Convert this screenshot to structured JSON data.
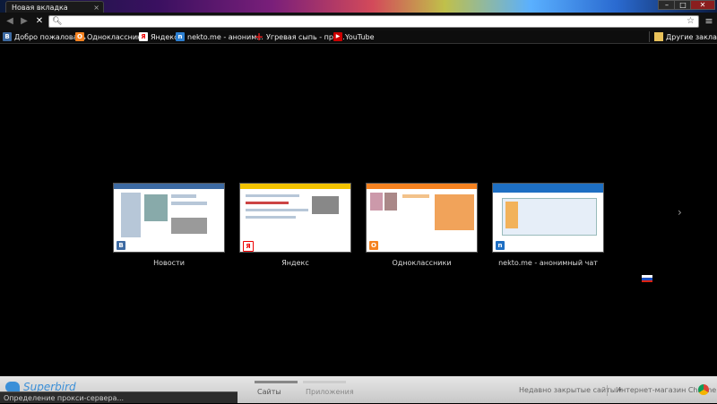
{
  "window": {
    "tab_title": "Новая вкладка",
    "tab_close": "×",
    "controls": [
      "–",
      "□",
      "✕"
    ]
  },
  "toolbar": {
    "back": "◀",
    "forward": "▶",
    "stop": "✕",
    "address_value": "",
    "search_icon": "search-icon",
    "star_icon": "star-icon",
    "menu": "≡"
  },
  "bookmarks": {
    "items": [
      {
        "label": "Добро пожаловать",
        "icon": "vk-icon",
        "color": "#3d6aa2",
        "glyph": "В"
      },
      {
        "label": "Одноклассники",
        "icon": "ok-icon",
        "color": "#f58220",
        "glyph": "О"
      },
      {
        "label": "Яндекс",
        "icon": "yandex-icon",
        "color": "#ffffff",
        "glyph": "Я"
      },
      {
        "label": "nekto.me - аноним...",
        "icon": "nekto-icon",
        "color": "#2c7fd1",
        "glyph": "n"
      },
      {
        "label": "Угревая сыпь - при...",
        "icon": "red-cross-icon",
        "color": "#e02020",
        "glyph": "+"
      },
      {
        "label": "YouTube",
        "icon": "youtube-icon",
        "color": "#cc0000",
        "glyph": "▶"
      }
    ],
    "other": "Другие закладки"
  },
  "most_visited": [
    {
      "label": "Новости",
      "accent": "#3d6aa2"
    },
    {
      "label": "Яндекс",
      "accent": "#f2c200"
    },
    {
      "label": "Одноклассники",
      "accent": "#f58220"
    },
    {
      "label": "nekto.me - анонимный чат",
      "accent": "#1e6fc3"
    }
  ],
  "pager": {
    "next": "›"
  },
  "bottom": {
    "logo_text": "Superbird",
    "tab_sites": "Сайты",
    "tab_apps": "Приложения",
    "recently_closed": "Недавно закрытые сайты",
    "store": "Интернет-магазин Chrome"
  },
  "status_text": "Определение прокси-сервера..."
}
